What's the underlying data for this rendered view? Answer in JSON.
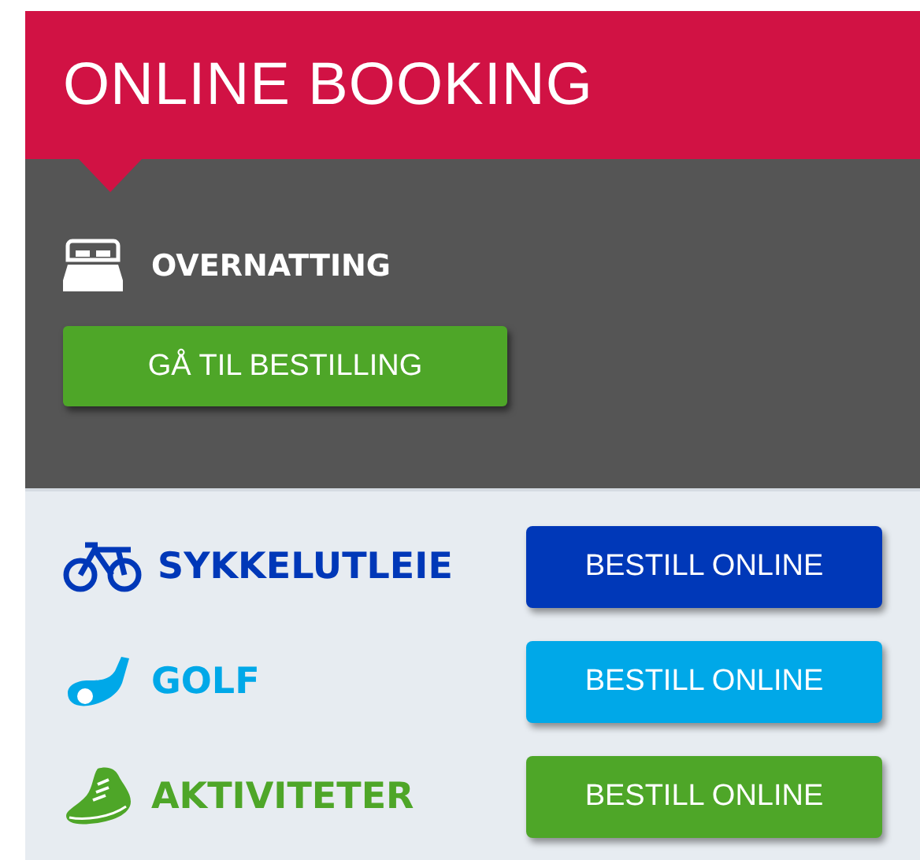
{
  "header": {
    "title": "ONLINE BOOKING"
  },
  "lodging": {
    "label": "OVERNATTING",
    "button": "GÅ TIL BESTILLING"
  },
  "services": [
    {
      "kind": "bicycle",
      "label": "SYKKELUTLEIE",
      "button": "BESTILL ONLINE",
      "color": "#0038b8"
    },
    {
      "kind": "golf",
      "label": "GOLF",
      "button": "BESTILL ONLINE",
      "color": "#00a8e8"
    },
    {
      "kind": "shoe",
      "label": "AKTIVITETER",
      "button": "BESTILL ONLINE",
      "color": "#4ea628"
    }
  ]
}
